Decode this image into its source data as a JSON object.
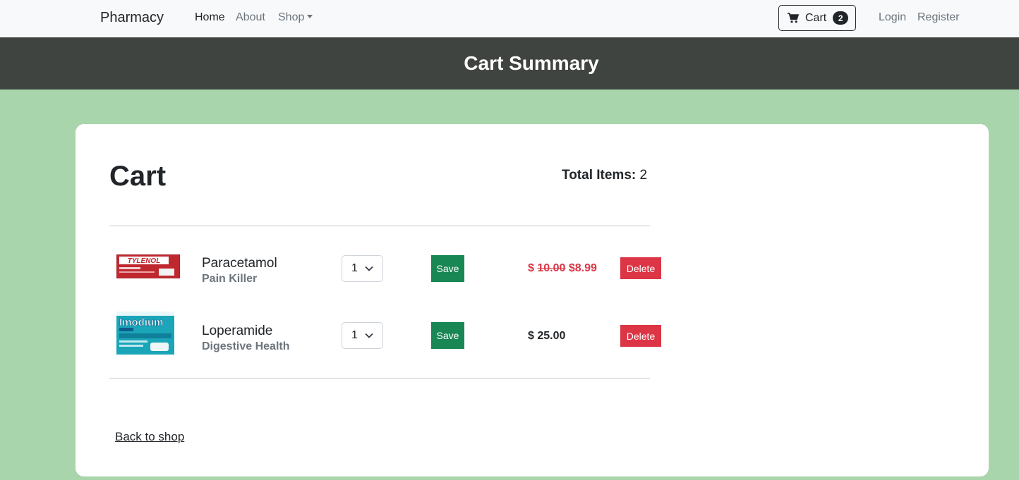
{
  "nav": {
    "brand": "Pharmacy",
    "links": [
      "Home",
      "About",
      "Shop"
    ],
    "cart_label": "Cart",
    "cart_count": "2",
    "login": "Login",
    "register": "Register"
  },
  "header": {
    "title": "Cart Summary"
  },
  "cart": {
    "title": "Cart",
    "total_label": "Total Items:",
    "total_value": "2",
    "items": [
      {
        "name": "Paracetamol",
        "category": "Pain Killer",
        "qty": "1",
        "save": "Save",
        "old_price": "10.00",
        "price": "$8.99",
        "currency": "$",
        "delete": "Delete",
        "thumb_icon": "tylenol-box-image",
        "thumb_text": "TYLENOL"
      },
      {
        "name": "Loperamide",
        "category": "Digestive Health",
        "qty": "1",
        "save": "Save",
        "price": "$ 25.00",
        "delete": "Delete",
        "thumb_icon": "imodium-box-image",
        "thumb_text": "Imodium"
      }
    ],
    "back_link": "Back to shop"
  },
  "colors": {
    "page_bg": "#a8d5ab",
    "header_bg": "#404441",
    "save": "#198754",
    "delete": "#dc3545",
    "sale_price": "#dc3545"
  }
}
